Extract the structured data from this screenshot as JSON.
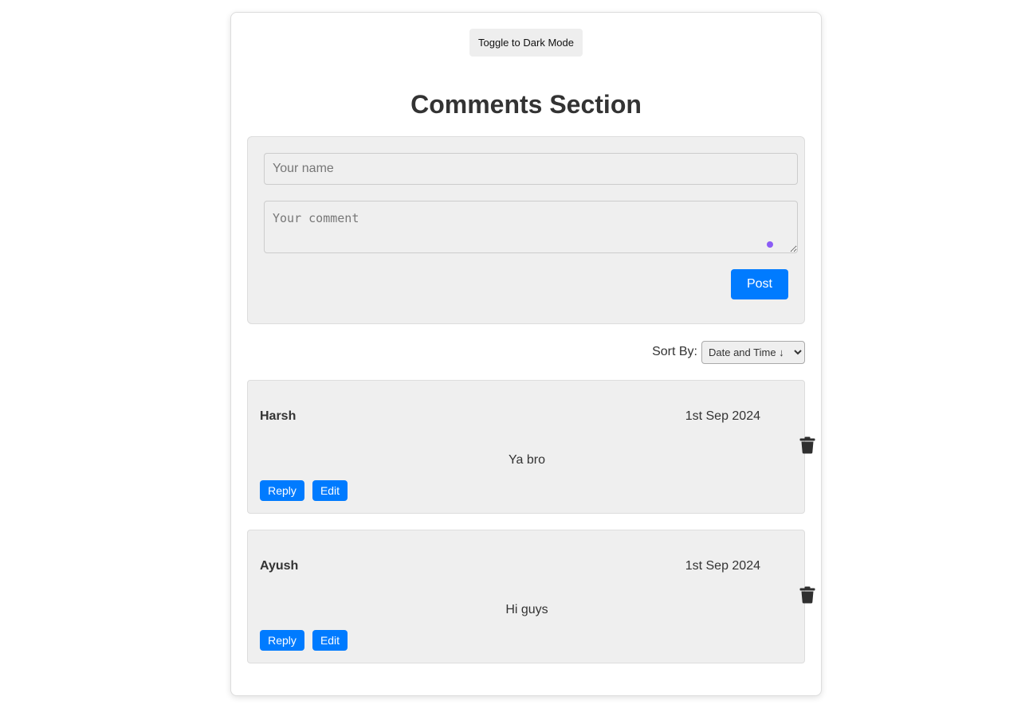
{
  "theme_toggle": {
    "label": "Toggle to Dark Mode"
  },
  "page": {
    "title": "Comments Section"
  },
  "form": {
    "name_placeholder": "Your name",
    "name_value": "",
    "comment_placeholder": "Your comment",
    "comment_value": "",
    "post_label": "Post"
  },
  "sort": {
    "label": "Sort By:",
    "selected": "Date and Time ↓"
  },
  "comments": [
    {
      "author": "Harsh",
      "date": "1st Sep 2024",
      "text": "Ya bro",
      "reply_label": "Reply",
      "edit_label": "Edit",
      "delete_icon": "trash-icon"
    },
    {
      "author": "Ayush",
      "date": "1st Sep 2024",
      "text": "Hi guys",
      "reply_label": "Reply",
      "edit_label": "Edit",
      "delete_icon": "trash-icon"
    }
  ],
  "colors": {
    "accent": "#007bff",
    "panel": "#efefef",
    "text": "#333333",
    "grammar_dot": "#8b5cf6"
  }
}
